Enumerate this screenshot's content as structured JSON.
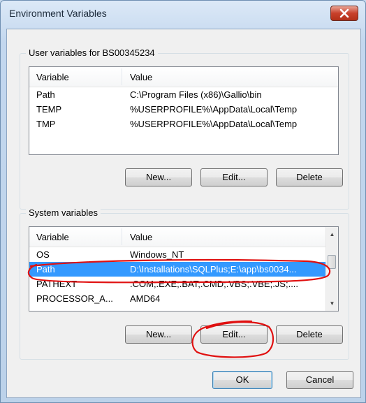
{
  "window": {
    "title": "Environment Variables",
    "close_icon": "close-icon"
  },
  "user_vars": {
    "group_label": "User variables for BS00345234",
    "columns": [
      "Variable",
      "Value"
    ],
    "rows": [
      {
        "variable": "Path",
        "value": "C:\\Program Files (x86)\\Gallio\\bin"
      },
      {
        "variable": "TEMP",
        "value": "%USERPROFILE%\\AppData\\Local\\Temp"
      },
      {
        "variable": "TMP",
        "value": "%USERPROFILE%\\AppData\\Local\\Temp"
      }
    ],
    "buttons": {
      "new": "New...",
      "edit": "Edit...",
      "delete": "Delete"
    }
  },
  "system_vars": {
    "group_label": "System variables",
    "columns": [
      "Variable",
      "Value"
    ],
    "rows": [
      {
        "variable": "OS",
        "value": "Windows_NT"
      },
      {
        "variable": "Path",
        "value": "D:\\Installations\\SQLPlus;E:\\app\\bs0034..."
      },
      {
        "variable": "PATHEXT",
        "value": ".COM;.EXE;.BAT;.CMD;.VBS;.VBE;.JS;...."
      },
      {
        "variable": "PROCESSOR_A...",
        "value": "AMD64"
      }
    ],
    "selected_row_index": 1,
    "buttons": {
      "new": "New...",
      "edit": "Edit...",
      "delete": "Delete"
    }
  },
  "footer": {
    "ok": "OK",
    "cancel": "Cancel"
  },
  "colors": {
    "selection": "#3399ff",
    "annotation": "#e01010",
    "close_button": "#c8402b"
  }
}
